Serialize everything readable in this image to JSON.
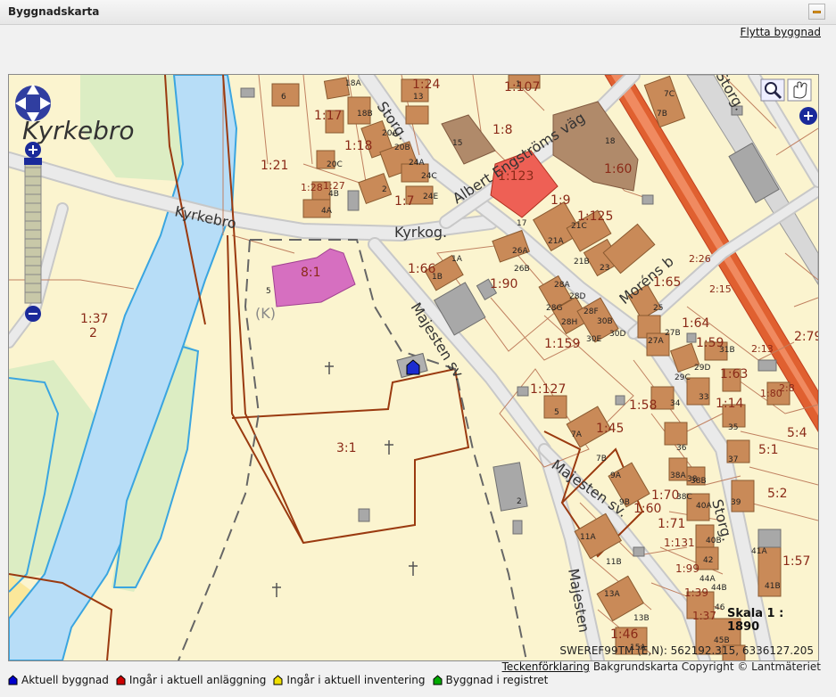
{
  "window": {
    "title": "Byggnadskarta",
    "minimize_icon": "minimize-icon"
  },
  "actions": {
    "move_building": "Flytta byggnad"
  },
  "map": {
    "place_label": "Kyrkebro",
    "roads": [
      "Kyrkebro",
      "Kyrkog.",
      "Storg.",
      "Albert Engströms väg",
      "Majesten sv.",
      "Majesten sv.",
      "Majesten",
      "Moréns b",
      "Storg.",
      "Storg."
    ],
    "parcel_labels": [
      "1:24",
      "1:107",
      "1:17",
      "1:18",
      "1:21",
      "1:8",
      "1:123",
      "1:60",
      "1:9",
      "1:125",
      "1:28",
      "1:27",
      "1:7",
      "1:66",
      "1:90",
      "1:65",
      "1:64",
      "1:59",
      "1:63",
      "1:14",
      "1:80",
      "1:159",
      "1:127",
      "1:58",
      "1:45",
      "1:70",
      "1:71",
      "1:131",
      "1:99",
      "1:39",
      "1:37",
      "1:46",
      "1:60",
      "1:57",
      "1:37",
      "2",
      "8:1",
      "3:1",
      "5:1",
      "5:2",
      "5:4",
      "2:79",
      "2:13",
      "2:15",
      "2:26",
      "2:8"
    ],
    "building_labels": [
      "6",
      "18A",
      "18B",
      "20A",
      "20B",
      "20C",
      "24A",
      "24C",
      "24E",
      "4B",
      "4A",
      "2",
      "13",
      "15",
      "1",
      "18",
      "7C",
      "7B",
      "17",
      "21A",
      "21C",
      "21B",
      "23",
      "26A",
      "26B",
      "1A",
      "1B",
      "28A",
      "28D",
      "28G",
      "28H",
      "28F",
      "30B",
      "30D",
      "30E",
      "25",
      "27B",
      "27A",
      "29D",
      "29C",
      "31B",
      "33",
      "34",
      "35",
      "36",
      "37",
      "38",
      "38A",
      "38B",
      "38C",
      "39",
      "40A",
      "40B",
      "42",
      "44A",
      "44B",
      "45B",
      "46",
      "5",
      "7A",
      "7B",
      "9A",
      "9B",
      "11A",
      "11B",
      "13A",
      "13B",
      "15A",
      "41A",
      "41B",
      "2",
      "5",
      "(K)"
    ],
    "scale_text": "Skala 1 : 1890",
    "coord_text": "SWEREF99TM (E,N): 562192.315, 6336127.205",
    "tools": [
      "zoom-box-icon",
      "pan-hand-icon",
      "expand-plus-icon"
    ],
    "nav": [
      "pan-up-icon",
      "pan-down-icon",
      "pan-left-icon",
      "pan-right-icon",
      "zoom-in-icon",
      "zoom-out-icon"
    ]
  },
  "footer": {
    "legend_link": "Teckenförklaring",
    "copyright": "Bakgrundskarta Copyright © Lantmäteriet"
  },
  "legend": [
    {
      "label": "Aktuell byggnad",
      "color": "#0000cc"
    },
    {
      "label": "Ingår i aktuell anläggning",
      "color": "#cc0000"
    },
    {
      "label": "Ingår i aktuell inventering",
      "color": "#f0e000"
    },
    {
      "label": "Byggnad i registret",
      "color": "#00aa00"
    }
  ]
}
